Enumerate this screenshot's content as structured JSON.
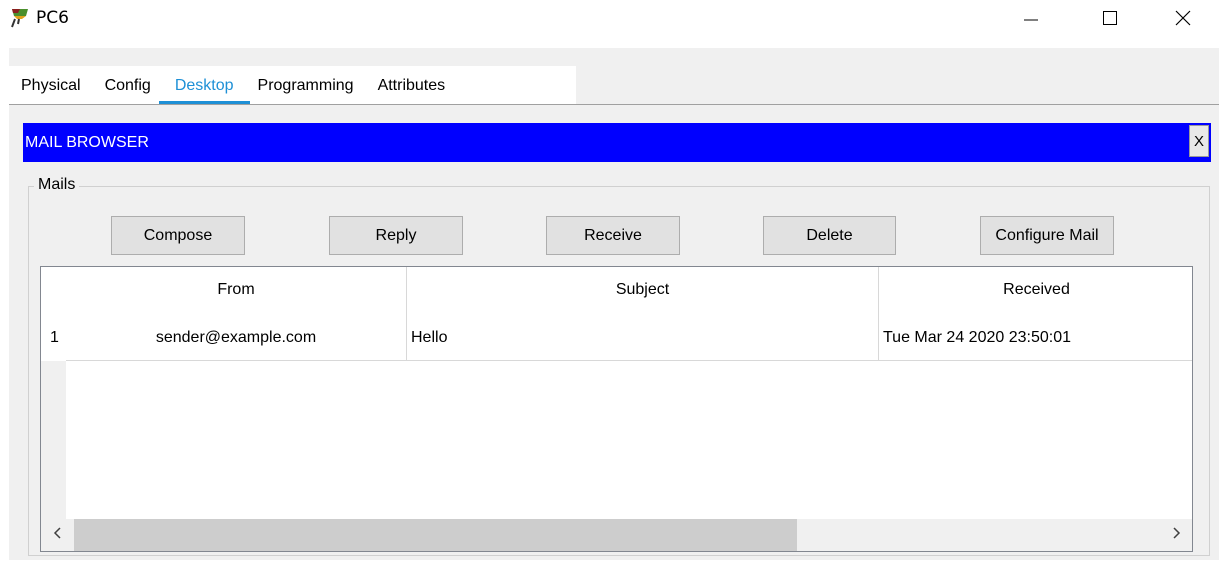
{
  "window": {
    "title": "PC6"
  },
  "tabs": [
    {
      "label": "Physical",
      "active": false
    },
    {
      "label": "Config",
      "active": false
    },
    {
      "label": "Desktop",
      "active": true
    },
    {
      "label": "Programming",
      "active": false
    },
    {
      "label": "Attributes",
      "active": false
    }
  ],
  "mail_browser": {
    "title": "MAIL BROWSER",
    "close_label": "X",
    "group_label": "Mails",
    "buttons": {
      "compose": "Compose",
      "reply": "Reply",
      "receive": "Receive",
      "delete": "Delete",
      "configure": "Configure Mail"
    },
    "table": {
      "columns": [
        "From",
        "Subject",
        "Received"
      ],
      "rows": [
        {
          "index": "1",
          "from": "sender@example.com",
          "subject": "Hello",
          "received": "Tue Mar 24 2020 23:50:01"
        }
      ]
    }
  },
  "colors": {
    "accent_tab": "#1e90d6",
    "header_bar": "#0000ff"
  },
  "icons": {
    "app": "packet-tracer-pc-icon",
    "minimize": "minimize-icon",
    "maximize": "maximize-icon",
    "close": "close-icon",
    "scroll_left": "chevron-left-icon",
    "scroll_right": "chevron-right-icon"
  }
}
